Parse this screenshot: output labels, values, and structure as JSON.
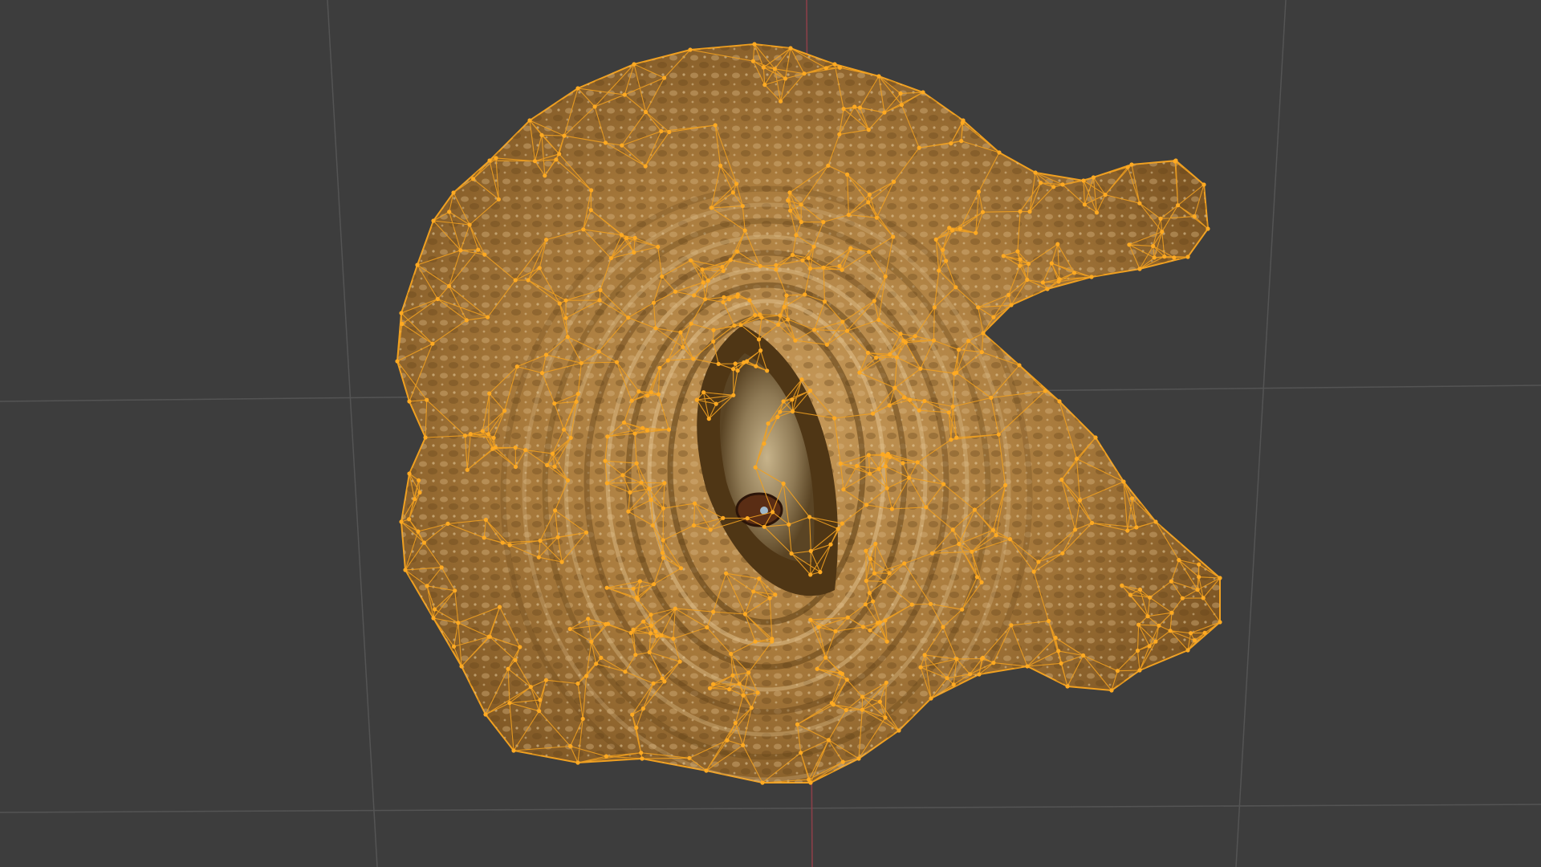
{
  "viewport": {
    "mode": "edit-mode",
    "object": "textured-mesh",
    "colors": {
      "background": "#3d3d3d",
      "grid_line": "#545454",
      "axis_y": "#8a3f48",
      "mesh_base": "#a87a3c",
      "mesh_dark": "#6e4a1e",
      "mesh_light": "#d6b27a",
      "wire": "#f0a020",
      "vertex": "#ffaa22",
      "eye_highlight": "#9fb7c9"
    }
  }
}
